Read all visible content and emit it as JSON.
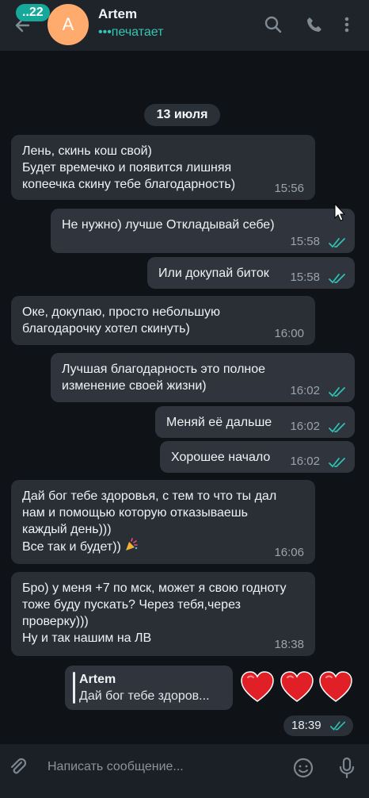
{
  "header": {
    "back_icon": "arrow-left-icon",
    "unread_count": "..22",
    "avatar_letter": "A",
    "contact_name": "Artem",
    "status": "•••печатает",
    "actions": [
      "search-icon",
      "phone-icon",
      "more-vertical-icon"
    ]
  },
  "chat": {
    "date": "13 июля",
    "messages": [
      {
        "dir": "in",
        "lines": [
          "Лень, скинь кош свой)",
          "Будет времечко и появится лишняя",
          "копеечка скину тебе благодарность)"
        ],
        "time": "15:56"
      },
      {
        "dir": "out",
        "lines": [
          "Не нужно) лучше Откладывай себе)"
        ],
        "time": "15:58",
        "read": true
      },
      {
        "dir": "out",
        "lines": [
          "Или докупай биток"
        ],
        "time": "15:58",
        "read": true
      },
      {
        "dir": "in",
        "lines": [
          "Оке, докупаю, просто небольшую",
          "благодарочку хотел скинуть)"
        ],
        "time": "16:00"
      },
      {
        "dir": "out",
        "lines": [
          "Лучшая благодарность это полное",
          "изменение своей жизни)"
        ],
        "time": "16:02",
        "read": true
      },
      {
        "dir": "out",
        "lines": [
          "Меняй её дальше"
        ],
        "time": "16:02",
        "read": true
      },
      {
        "dir": "out",
        "lines": [
          "Хорошее начало"
        ],
        "time": "16:02",
        "read": true
      },
      {
        "dir": "in",
        "lines": [
          "Дай бог тебе здоровья, с тем то что ты дал",
          "нам и помощью которую отказываешь",
          "каждый день)))",
          "Все так и будет))"
        ],
        "time": "16:06",
        "emoji": "party-popper"
      },
      {
        "dir": "in",
        "lines": [
          "Бро) у меня +7 по мск, может я свою годноту",
          "тоже буду пускать? Через тебя,через",
          "проверку)))",
          "Ну и так нашим на ЛВ"
        ],
        "time": "18:38"
      }
    ],
    "reply": {
      "name": "Artem",
      "text": "Дай бог тебе здоров..."
    },
    "reactions": [
      "heart",
      "heart",
      "heart"
    ],
    "last_time": "18:39"
  },
  "composer": {
    "placeholder": "Написать сообщение...",
    "attach_icon": "paperclip-icon",
    "emoji_icon": "smile-icon",
    "mic_icon": "microphone-icon"
  },
  "colors": {
    "accent": "#16a89a",
    "bg": "#0f1217",
    "bubble_in": "#2a2f36",
    "bubble_out": "#30353d"
  }
}
